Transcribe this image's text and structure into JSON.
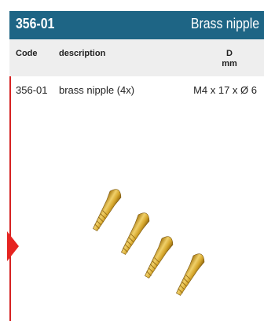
{
  "header": {
    "code": "356-01",
    "title": "Brass nipple"
  },
  "table": {
    "columns": {
      "code": "Code",
      "description": "description",
      "d_label": "D",
      "d_unit": "mm"
    },
    "rows": [
      {
        "code": "356-01",
        "description": "brass nipple (4x)",
        "d": "M4 x 17 x Ø 6"
      }
    ]
  },
  "colors": {
    "header_bg": "#1e6585",
    "table_header_bg": "#eeeeee",
    "accent_red": "#e62421",
    "brass": "#d9b13b"
  }
}
